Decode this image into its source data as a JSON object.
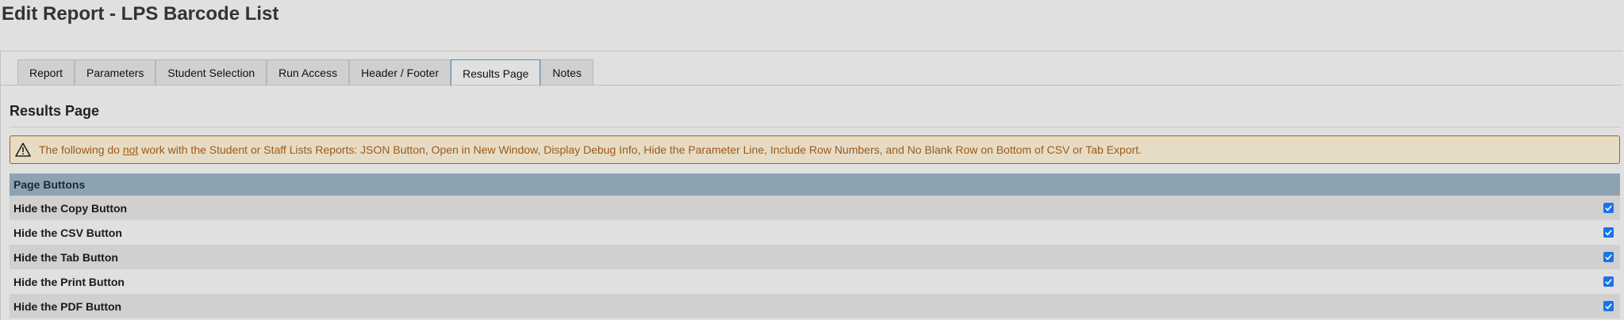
{
  "page": {
    "title": "Edit Report - LPS Barcode List"
  },
  "tabs": [
    {
      "label": "Report",
      "active": false
    },
    {
      "label": "Parameters",
      "active": false
    },
    {
      "label": "Student Selection",
      "active": false
    },
    {
      "label": "Run Access",
      "active": false
    },
    {
      "label": "Header / Footer",
      "active": false
    },
    {
      "label": "Results Page",
      "active": true
    },
    {
      "label": "Notes",
      "active": false
    }
  ],
  "section": {
    "title": "Results Page"
  },
  "warning": {
    "icon": "warning-icon",
    "text_before": "The following do ",
    "text_underlined": "not",
    "text_after": " work with the Student or Staff Lists Reports: JSON Button, Open in New Window, Display Debug Info, Hide the Parameter Line, Include Row Numbers, and No Blank Row on Bottom of CSV or Tab Export."
  },
  "page_buttons": {
    "header": "Page Buttons",
    "rows": [
      {
        "label": "Hide the Copy Button",
        "checked": true
      },
      {
        "label": "Hide the CSV Button",
        "checked": true
      },
      {
        "label": "Hide the Tab Button",
        "checked": true
      },
      {
        "label": "Hide the Print Button",
        "checked": true
      },
      {
        "label": "Hide the PDF Button",
        "checked": true
      }
    ]
  },
  "colors": {
    "accent": "#1a73e8",
    "warning_border": "#b35c1e",
    "warning_text": "#9c5a1a",
    "table_header": "#8ea3b1"
  }
}
